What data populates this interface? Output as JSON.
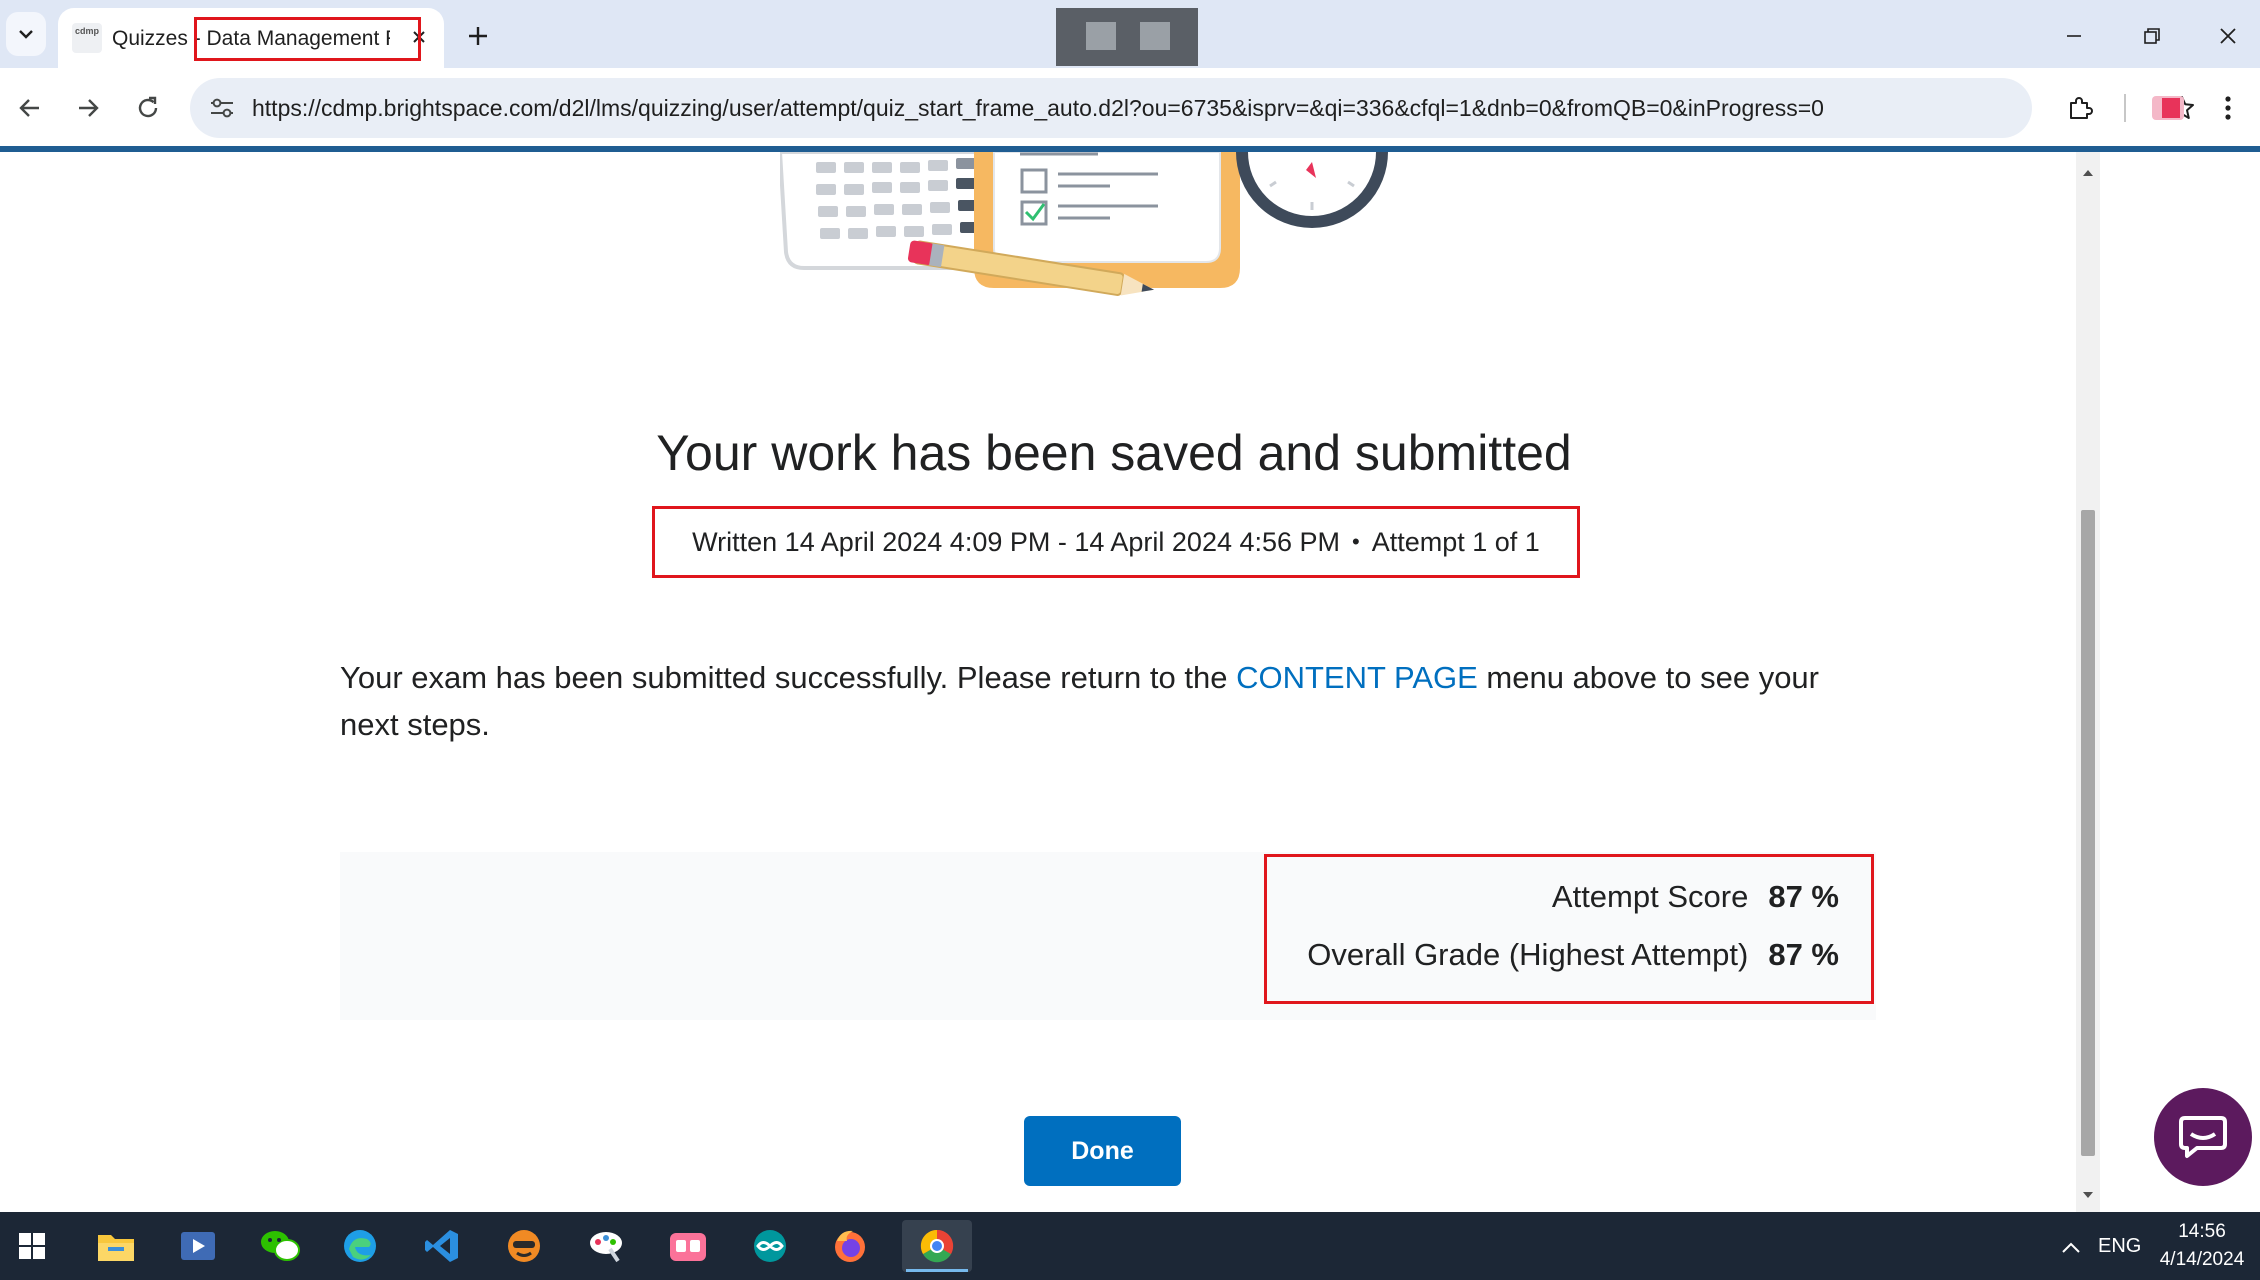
{
  "browser": {
    "tab": {
      "title": "Quizzes - Data Management Fu",
      "favicon_text": "cdmp"
    },
    "url": "https://cdmp.brightspace.com/d2l/lms/quizzing/user/attempt/quiz_start_frame_auto.d2l?ou=6735&isprv=&qi=336&cfql=1&dnb=0&fromQB=0&inProgress=0"
  },
  "page": {
    "heading": "Your work has been saved and submitted",
    "meta": {
      "written": "Written 14 April 2024 4:09 PM - 14 April 2024 4:56 PM",
      "separator": "•",
      "attempt": "Attempt 1 of 1"
    },
    "message": {
      "before": "Your exam has been submitted successfully. Please return to the ",
      "link": "CONTENT PAGE",
      "after": " menu above to see your next steps."
    },
    "scores": {
      "attempt_label": "Attempt Score",
      "attempt_value": "87 %",
      "overall_label": "Overall Grade (Highest Attempt)",
      "overall_value": "87 %"
    },
    "done_label": "Done"
  },
  "taskbar": {
    "apps": [
      "start-icon",
      "file-explorer-icon",
      "media-player-icon",
      "wechat-icon",
      "edge-icon",
      "vscode-icon",
      "fox-app-icon",
      "paint-app-icon",
      "bilibili-icon",
      "arduino-icon",
      "firefox-icon",
      "chrome-icon"
    ],
    "language": "ENG",
    "time": "14:56",
    "date": "4/14/2024"
  },
  "colors": {
    "accent": "#006fbf",
    "highlight": "#e0161c",
    "chat": "#5c1a5e",
    "taskbar": "#1c2736"
  }
}
